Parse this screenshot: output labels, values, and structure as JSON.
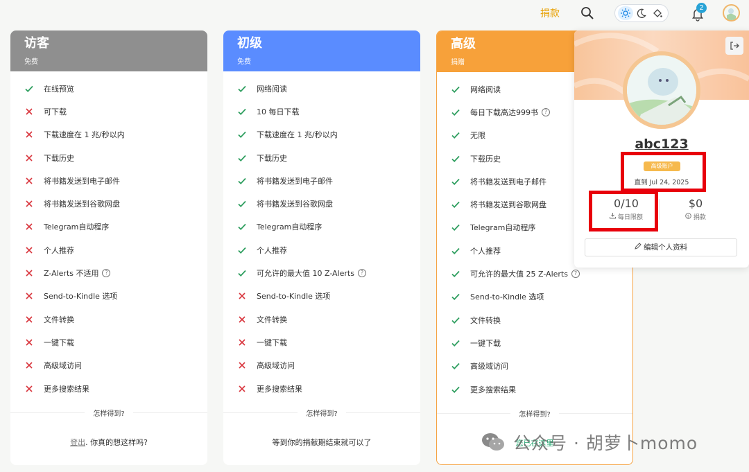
{
  "topbar": {
    "donate_label": "捐款",
    "notification_count": "2",
    "icons": {
      "search": "search-icon",
      "theme_light": "sun-icon",
      "theme_dark": "moon-icon",
      "theme_custom": "paint-bucket-icon",
      "bell": "bell-icon"
    }
  },
  "plans": [
    {
      "title": "访客",
      "subtitle": "免费",
      "color": "#8f8f8f",
      "features": [
        {
          "label": "在线预览",
          "ok": true
        },
        {
          "label": "可下载",
          "ok": false
        },
        {
          "label": "下载速度在 1 兆/秒以内",
          "ok": false
        },
        {
          "label": "下载历史",
          "ok": false
        },
        {
          "label": "将书籍发送到电子邮件",
          "ok": false
        },
        {
          "label": "将书籍发送到谷歌网盘",
          "ok": false
        },
        {
          "label": "Telegram自动程序",
          "ok": false
        },
        {
          "label": "个人推荐",
          "ok": false
        },
        {
          "label": "Z-Alerts 不适用",
          "ok": false,
          "help": true
        },
        {
          "label": "Send-to-Kindle 选项",
          "ok": false
        },
        {
          "label": "文件转换",
          "ok": false
        },
        {
          "label": "一键下载",
          "ok": false
        },
        {
          "label": "高级域访问",
          "ok": false
        },
        {
          "label": "更多搜索结果",
          "ok": false
        }
      ],
      "how_to": "怎样得到?",
      "footer_link": "登出",
      "footer_text": ". 你真的想这样吗?"
    },
    {
      "title": "初级",
      "subtitle": "免费",
      "color": "#5a8cff",
      "features": [
        {
          "label": "网络阅读",
          "ok": true
        },
        {
          "label": "10 每日下载",
          "ok": true
        },
        {
          "label": "下载速度在 1 兆/秒以内",
          "ok": true
        },
        {
          "label": "下载历史",
          "ok": true
        },
        {
          "label": "将书籍发送到电子邮件",
          "ok": true
        },
        {
          "label": "将书籍发送到谷歌网盘",
          "ok": true
        },
        {
          "label": "Telegram自动程序",
          "ok": true
        },
        {
          "label": "个人推荐",
          "ok": true
        },
        {
          "label": "可允许的最大值 10 Z-Alerts",
          "ok": true,
          "help": true
        },
        {
          "label": "Send-to-Kindle 选项",
          "ok": false
        },
        {
          "label": "文件转换",
          "ok": false
        },
        {
          "label": "一键下载",
          "ok": false
        },
        {
          "label": "高级域访问",
          "ok": false
        },
        {
          "label": "更多搜索结果",
          "ok": false
        }
      ],
      "how_to": "怎样得到?",
      "footer_text": "等到你的捐献期结束就可以了"
    },
    {
      "title": "高级",
      "subtitle": "捐赠",
      "color": "#f7a13a",
      "features": [
        {
          "label": "网络阅读",
          "ok": true
        },
        {
          "label": "每日下载高达999书",
          "ok": true,
          "help": true
        },
        {
          "label": "无限",
          "ok": true
        },
        {
          "label": "下载历史",
          "ok": true
        },
        {
          "label": "将书籍发送到电子邮件",
          "ok": true
        },
        {
          "label": "将书籍发送到谷歌网盘",
          "ok": true
        },
        {
          "label": "Telegram自动程序",
          "ok": true
        },
        {
          "label": "个人推荐",
          "ok": true
        },
        {
          "label": "可允许的最大值 25 Z-Alerts",
          "ok": true,
          "help": true
        },
        {
          "label": "Send-to-Kindle 选项",
          "ok": true
        },
        {
          "label": "文件转换",
          "ok": true
        },
        {
          "label": "一键下载",
          "ok": true
        },
        {
          "label": "高级域访问",
          "ok": true
        },
        {
          "label": "更多搜索结果",
          "ok": true
        }
      ],
      "how_to": "怎样得到?",
      "footer_text": "您已在这里"
    }
  ],
  "profile": {
    "username": "abc123",
    "tier_badge": "高级账户",
    "valid_until": "直到 Jul 24, 2025",
    "quota_value": "0/10",
    "quota_label": "每日限额",
    "donated_value": "$0",
    "donated_label": "捐款",
    "edit_label": "编辑个人资料",
    "logout_icon": "logout-icon"
  },
  "watermark": {
    "text": "公众号 · 胡萝卜momo",
    "icon": "wechat-icon"
  },
  "colors": {
    "check": "#2e9e5f",
    "cross": "#d9363e",
    "accent": "#e8a000",
    "highlight_box": "#e8000b"
  }
}
